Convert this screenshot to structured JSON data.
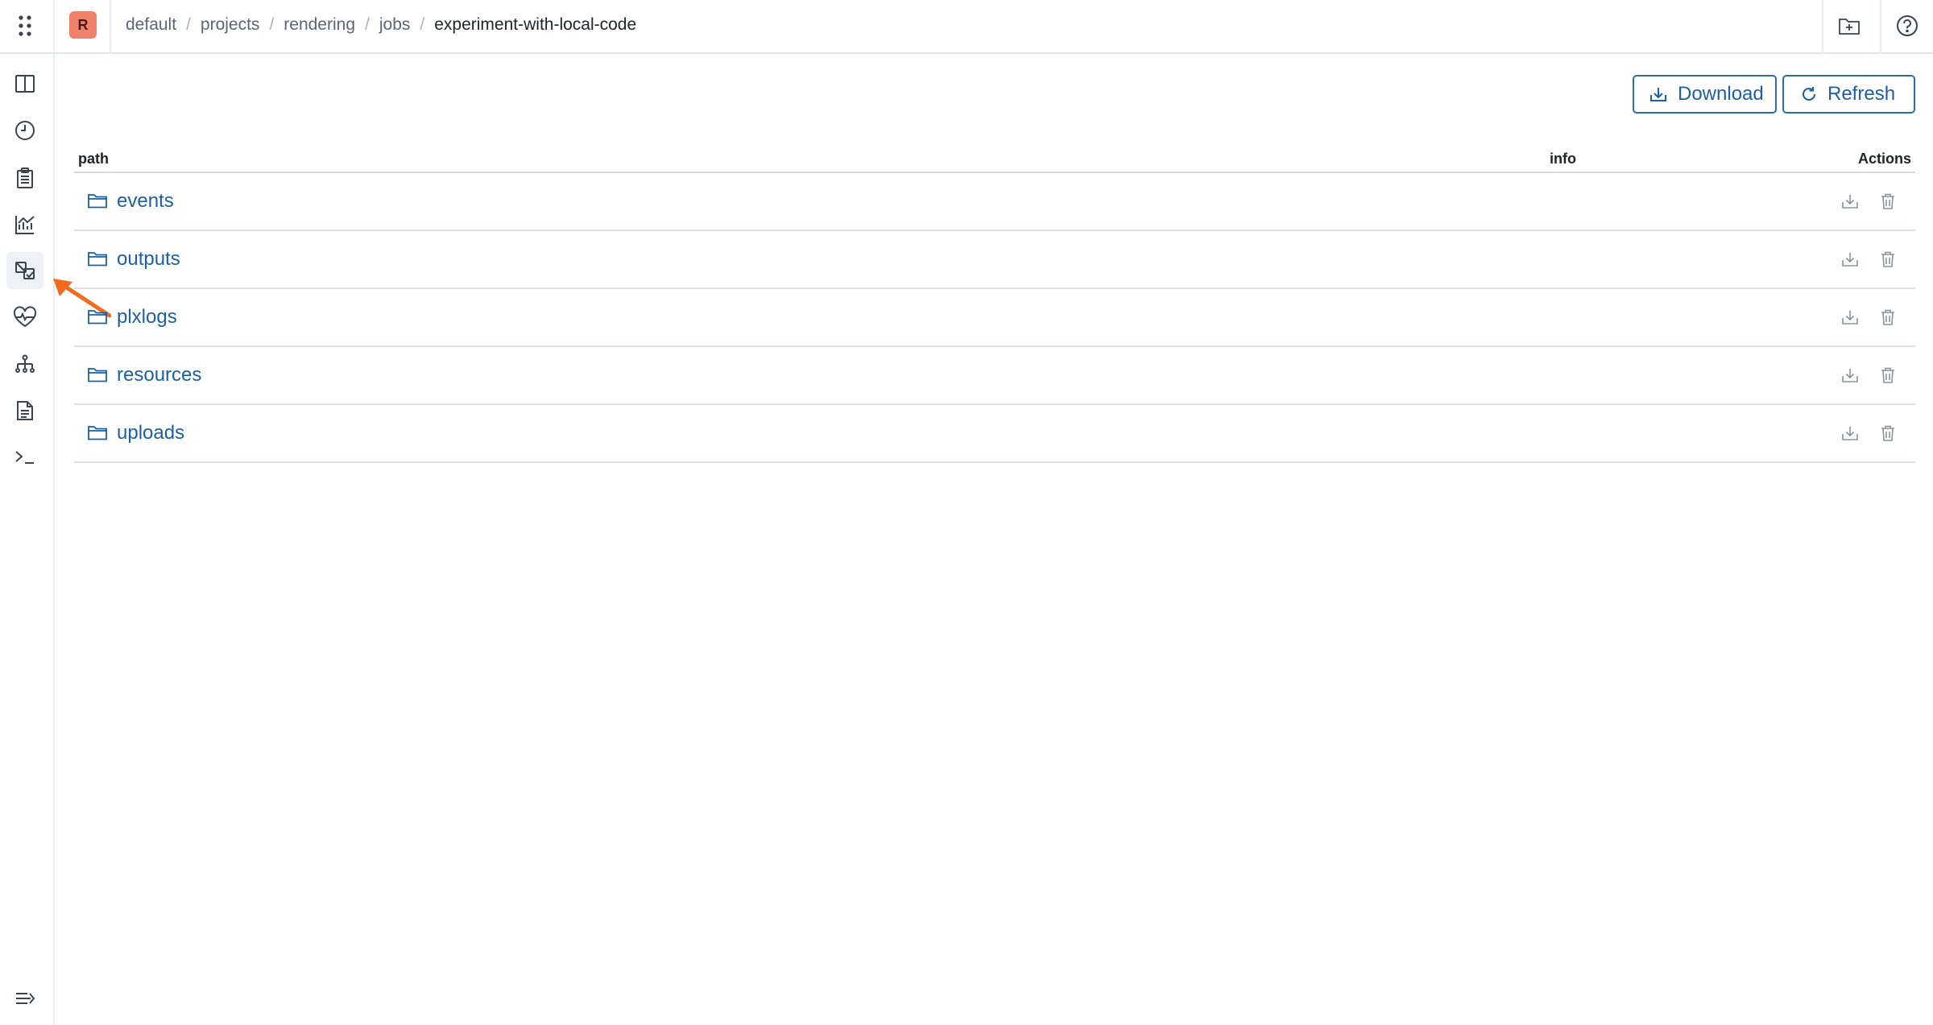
{
  "header": {
    "avatar_letter": "R",
    "breadcrumb": [
      "default",
      "projects",
      "rendering",
      "jobs"
    ],
    "breadcrumb_separator": "/",
    "current": "experiment-with-local-code",
    "icons": [
      "grid-menu-icon",
      "new-folder-icon",
      "help-icon"
    ]
  },
  "sidebar": {
    "items": [
      {
        "name": "split-view-icon",
        "active": false
      },
      {
        "name": "clock-icon",
        "active": false
      },
      {
        "name": "clipboard-icon",
        "active": false
      },
      {
        "name": "chart-icon",
        "active": false
      },
      {
        "name": "artifacts-icon",
        "active": true
      },
      {
        "name": "heart-pulse-icon",
        "active": false
      },
      {
        "name": "hierarchy-icon",
        "active": false
      },
      {
        "name": "document-icon",
        "active": false
      },
      {
        "name": "terminal-icon",
        "active": false
      }
    ],
    "collapse_icon": "collapse-menu-icon"
  },
  "toolbar": {
    "download_label": "Download",
    "refresh_label": "Refresh"
  },
  "table": {
    "columns": [
      "path",
      "info",
      "Actions"
    ],
    "rows": [
      {
        "path": "events",
        "info": ""
      },
      {
        "path": "outputs",
        "info": ""
      },
      {
        "path": "plxlogs",
        "info": ""
      },
      {
        "path": "resources",
        "info": ""
      },
      {
        "path": "uploads",
        "info": ""
      }
    ]
  },
  "colors": {
    "accent": "#1d5fa3",
    "avatar": "#f0816a",
    "annotation": "#f26a1b"
  }
}
